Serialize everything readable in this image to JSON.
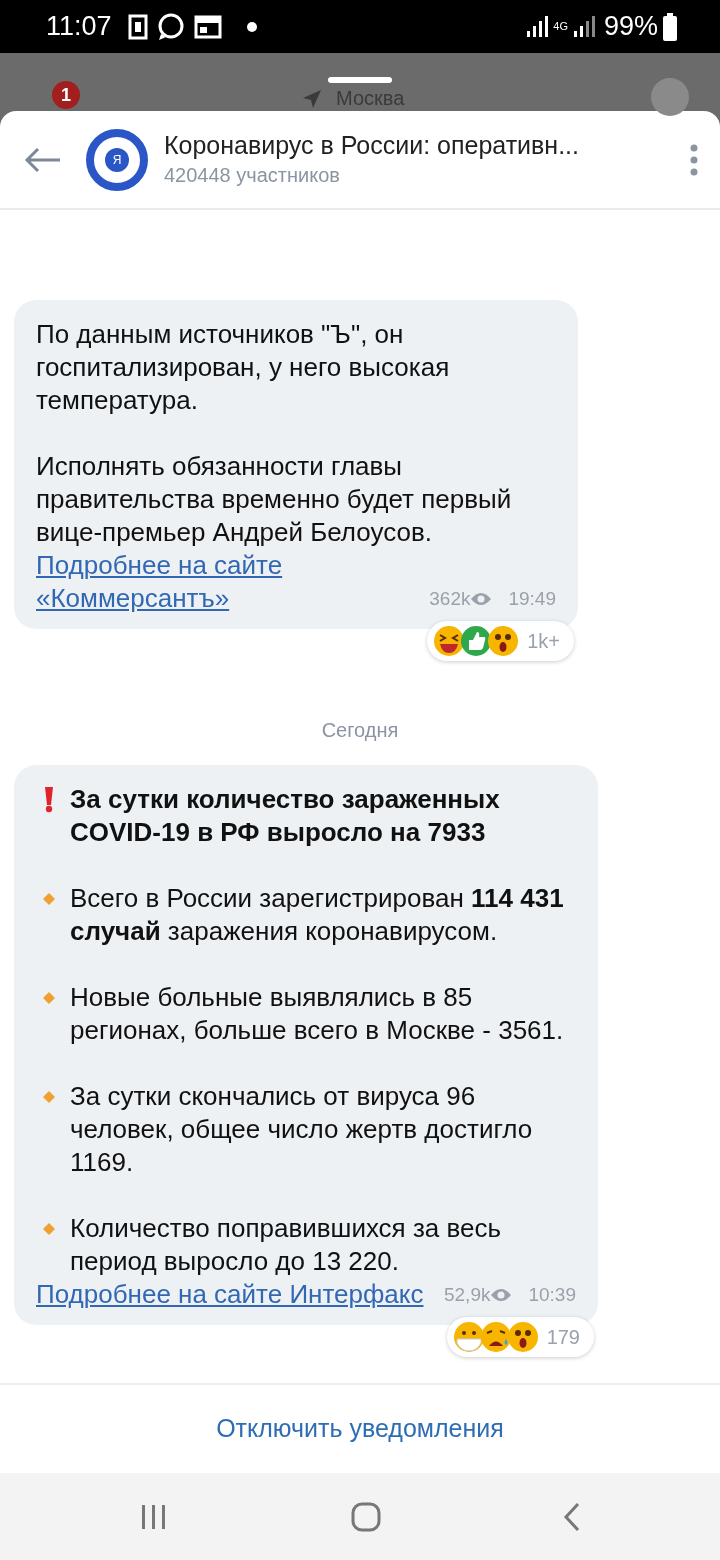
{
  "status_bar": {
    "time": "11:07",
    "network": "4G",
    "battery": "99%"
  },
  "background_app": {
    "badge": "1",
    "location": "Москва"
  },
  "header": {
    "avatar_letter": "Я",
    "title": "Коронавирус в России: оперативн...",
    "subtitle": "420448 участников"
  },
  "feed": [
    {
      "kind": "message",
      "blocks": [
        {
          "kind": "plain",
          "text": "По данным источников \"Ъ\", он госпитализирован, у него высокая температура."
        },
        {
          "kind": "plain",
          "text": "Исполнять обязанности главы правительства временно будет первый вице-премьер Андрей Белоусов."
        }
      ],
      "link": "Подробнее на сайте «Коммерсантъ»",
      "views": "362k",
      "time": "19:49",
      "reactions": {
        "emojis": [
          {
            "kind": "laugh"
          },
          {
            "kind": "like"
          },
          {
            "kind": "wow"
          }
        ],
        "count": "1k+"
      }
    },
    {
      "kind": "date",
      "text": "Сегодня"
    },
    {
      "kind": "message",
      "blocks": [
        {
          "kind": "title",
          "text": "За сутки количество зараженных COVID-19 в РФ выросло на 7933"
        },
        {
          "kind": "bullet",
          "text": "Всего в России зарегистрирован **114 431 случай** заражения коронавирусом."
        },
        {
          "kind": "bullet",
          "text": "Новые больные выявлялись в 85 регионах, больше всего в Москве - 3561."
        },
        {
          "kind": "bullet",
          "text": "За сутки скончались от вируса 96 человек, общее число жертв достигло 1169."
        },
        {
          "kind": "bullet",
          "text": "Количество поправившихся за весь период выросло до 13 220."
        }
      ],
      "link": "Подробнее на сайте Интерфакс",
      "views": "52,9k",
      "time": "10:39",
      "reactions": {
        "emojis": [
          {
            "kind": "mask"
          },
          {
            "kind": "cry"
          },
          {
            "kind": "wow"
          }
        ],
        "count": "179"
      }
    }
  ],
  "footer_button": "Отключить уведомления"
}
